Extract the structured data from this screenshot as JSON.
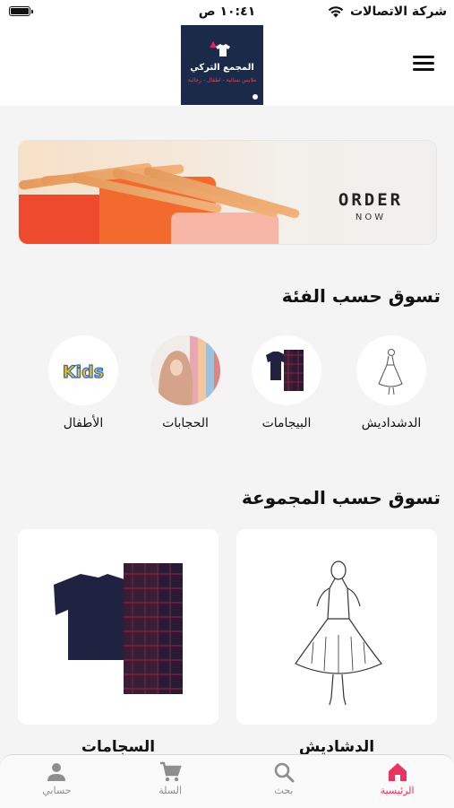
{
  "status_bar": {
    "carrier": "شركة الاتصالات",
    "time": "١٠:٤١ ص"
  },
  "header": {
    "logo_title": "المجمع التركي",
    "logo_subtitle": "ملابس نسائية - اطفال - رجالية"
  },
  "banner": {
    "order_text": "ORDER",
    "now_text": "NOW"
  },
  "categories_section": {
    "title": "تسوق حسب الفئة",
    "items": [
      {
        "label": "الدشداديش",
        "icon": "dress-sketch-icon"
      },
      {
        "label": "البيجامات",
        "icon": "pajamas-icon"
      },
      {
        "label": "الحجابات",
        "icon": "hijab-icon"
      },
      {
        "label": "الأطفال",
        "icon": "kids-icon",
        "badge_text": "Kids"
      }
    ]
  },
  "groups_section": {
    "title": "تسوق حسب المجموعة",
    "items": [
      {
        "label": "الدشاديش",
        "icon": "dress-sketch-icon"
      },
      {
        "label": "السجامات",
        "icon": "pajamas-icon"
      }
    ]
  },
  "bottom_nav": {
    "items": [
      {
        "label": "الرئيسية",
        "icon": "home-icon",
        "active": true
      },
      {
        "label": "بحث",
        "icon": "search-icon",
        "active": false
      },
      {
        "label": "السلة",
        "icon": "cart-icon",
        "active": false
      },
      {
        "label": "حسابي",
        "icon": "account-icon",
        "active": false
      }
    ]
  },
  "colors": {
    "accent": "#e8355f",
    "logo_background": "#1c2a4a",
    "page_background": "#f4f4f4"
  }
}
